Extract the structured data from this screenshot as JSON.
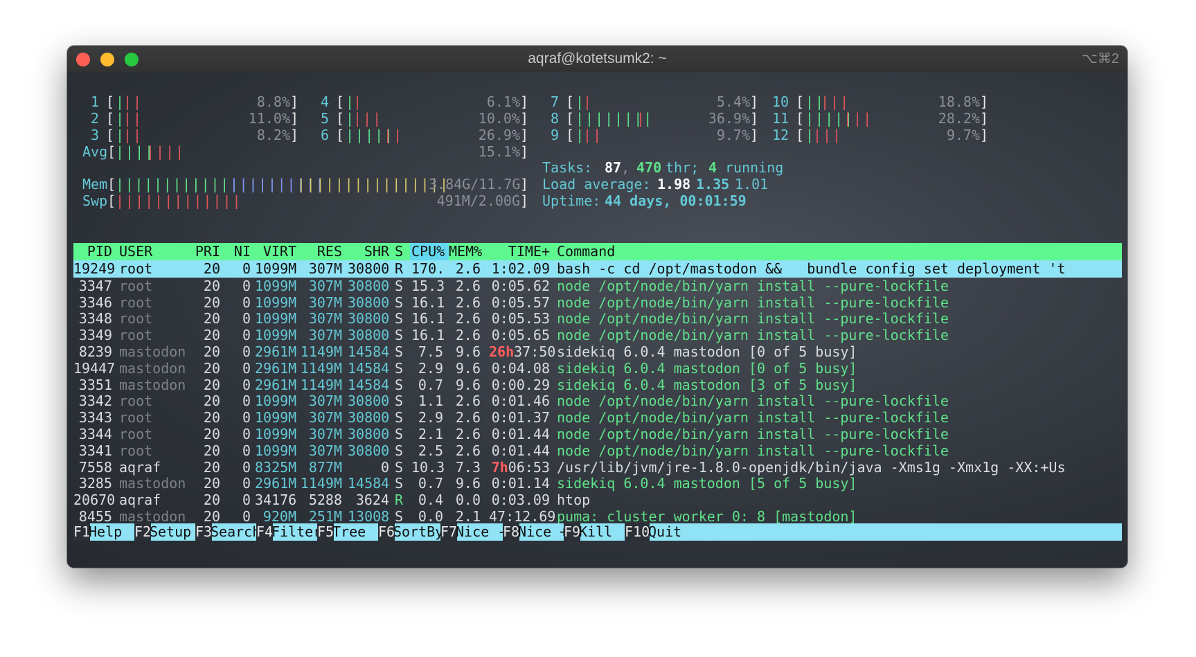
{
  "window": {
    "title": "aqraf@kotetsumk2: ~",
    "shortcut": "⌥⌘2"
  },
  "meters": {
    "cpus": [
      {
        "id": "1",
        "pct": "8.8%",
        "green": "|",
        "red": "||"
      },
      {
        "id": "2",
        "pct": "11.0%",
        "green": "|",
        "red": "||"
      },
      {
        "id": "3",
        "pct": "8.2%",
        "green": "|",
        "red": "||"
      },
      {
        "id": "4",
        "pct": "6.1%",
        "green": "|",
        "red": "|"
      },
      {
        "id": "5",
        "pct": "10.0%",
        "green": "|",
        "red": "|||"
      },
      {
        "id": "6",
        "pct": "26.9%",
        "green": "|||||",
        "red": "||"
      },
      {
        "id": "7",
        "pct": "5.4%",
        "green": "|",
        "red": "|"
      },
      {
        "id": "8",
        "pct": "36.9%",
        "green": "||||||||",
        "red": "|"
      },
      {
        "id": "9",
        "pct": "9.7%",
        "green": "|",
        "red": "||"
      },
      {
        "id": "10",
        "pct": "18.8%",
        "green": "||",
        "red": "|||"
      },
      {
        "id": "11",
        "pct": "28.2%",
        "green": "|||||",
        "red": "|||"
      },
      {
        "id": "12",
        "pct": "9.7%",
        "green": "|",
        "red": "|||"
      }
    ],
    "avg": {
      "label": "Avg",
      "pct": "15.1%",
      "green": "||||",
      "red": "||||"
    },
    "mem": {
      "label": "Mem",
      "green": "|||||||||||||||||",
      "blue": "||||||||||",
      "yellow": "||||||||||||||||",
      "value": "3.84G/11.7G"
    },
    "swp": {
      "label": "Swp",
      "red": "|||||||||||||",
      "value": "491M/2.00G"
    }
  },
  "stats": {
    "tasks_label": "Tasks:",
    "tasks": "87",
    "sep1": ",",
    "thr": "470",
    "thr_label": "thr;",
    "running": "4",
    "running_label": "running",
    "load_label": "Load average:",
    "load1": "1.98",
    "load5": "1.35",
    "load15": "1.01",
    "uptime_label": "Uptime:",
    "uptime": "44 days, 00:01:59"
  },
  "table": {
    "headers": {
      "pid": "PID",
      "user": "USER",
      "pri": "PRI",
      "ni": "NI",
      "virt": "VIRT",
      "res": "RES",
      "shr": "SHR",
      "s": "S",
      "cpu": "CPU%",
      "mem": "MEM%",
      "time": "TIME+",
      "cmd": "Command"
    },
    "rows": [
      {
        "pid": "19249",
        "user": "root",
        "pri": "20",
        "ni": "0",
        "virt": "1099M",
        "res": "307M",
        "shr": "30800",
        "s": "R",
        "cpu": "170.",
        "mem": "2.6",
        "time_h": "",
        "time": "1:02.09",
        "cmd": "bash -c cd /opt/mastodon &&   bundle config set deployment 't"
      },
      {
        "pid": "3347",
        "user": "root",
        "pri": "20",
        "ni": "0",
        "virt": "1099M",
        "res": "307M",
        "shr": "30800",
        "s": "S",
        "cpu": "15.3",
        "mem": "2.6",
        "time_h": "",
        "time": "0:05.62",
        "cmd": "node /opt/node/bin/yarn install --pure-lockfile"
      },
      {
        "pid": "3346",
        "user": "root",
        "pri": "20",
        "ni": "0",
        "virt": "1099M",
        "res": "307M",
        "shr": "30800",
        "s": "S",
        "cpu": "16.1",
        "mem": "2.6",
        "time_h": "",
        "time": "0:05.57",
        "cmd": "node /opt/node/bin/yarn install --pure-lockfile"
      },
      {
        "pid": "3348",
        "user": "root",
        "pri": "20",
        "ni": "0",
        "virt": "1099M",
        "res": "307M",
        "shr": "30800",
        "s": "S",
        "cpu": "16.1",
        "mem": "2.6",
        "time_h": "",
        "time": "0:05.53",
        "cmd": "node /opt/node/bin/yarn install --pure-lockfile"
      },
      {
        "pid": "3349",
        "user": "root",
        "pri": "20",
        "ni": "0",
        "virt": "1099M",
        "res": "307M",
        "shr": "30800",
        "s": "S",
        "cpu": "16.1",
        "mem": "2.6",
        "time_h": "",
        "time": "0:05.65",
        "cmd": "node /opt/node/bin/yarn install --pure-lockfile"
      },
      {
        "pid": "8239",
        "user": "mastodon",
        "pri": "20",
        "ni": "0",
        "virt": "2961M",
        "res": "1149M",
        "shr": "14584",
        "s": "S",
        "cpu": "7.5",
        "mem": "9.6",
        "time_h": "26h",
        "time": "37:50",
        "cmd": "sidekiq 6.0.4 mastodon [0 of 5 busy]"
      },
      {
        "pid": "19447",
        "user": "mastodon",
        "pri": "20",
        "ni": "0",
        "virt": "2961M",
        "res": "1149M",
        "shr": "14584",
        "s": "S",
        "cpu": "2.9",
        "mem": "9.6",
        "time_h": "",
        "time": "0:04.08",
        "cmd": "sidekiq 6.0.4 mastodon [0 of 5 busy]"
      },
      {
        "pid": "3351",
        "user": "mastodon",
        "pri": "20",
        "ni": "0",
        "virt": "2961M",
        "res": "1149M",
        "shr": "14584",
        "s": "S",
        "cpu": "0.7",
        "mem": "9.6",
        "time_h": "",
        "time": "0:00.29",
        "cmd": "sidekiq 6.0.4 mastodon [3 of 5 busy]"
      },
      {
        "pid": "3342",
        "user": "root",
        "pri": "20",
        "ni": "0",
        "virt": "1099M",
        "res": "307M",
        "shr": "30800",
        "s": "S",
        "cpu": "1.1",
        "mem": "2.6",
        "time_h": "",
        "time": "0:01.46",
        "cmd": "node /opt/node/bin/yarn install --pure-lockfile"
      },
      {
        "pid": "3343",
        "user": "root",
        "pri": "20",
        "ni": "0",
        "virt": "1099M",
        "res": "307M",
        "shr": "30800",
        "s": "S",
        "cpu": "2.9",
        "mem": "2.6",
        "time_h": "",
        "time": "0:01.37",
        "cmd": "node /opt/node/bin/yarn install --pure-lockfile"
      },
      {
        "pid": "3344",
        "user": "root",
        "pri": "20",
        "ni": "0",
        "virt": "1099M",
        "res": "307M",
        "shr": "30800",
        "s": "S",
        "cpu": "2.1",
        "mem": "2.6",
        "time_h": "",
        "time": "0:01.44",
        "cmd": "node /opt/node/bin/yarn install --pure-lockfile"
      },
      {
        "pid": "3341",
        "user": "root",
        "pri": "20",
        "ni": "0",
        "virt": "1099M",
        "res": "307M",
        "shr": "30800",
        "s": "S",
        "cpu": "2.5",
        "mem": "2.6",
        "time_h": "",
        "time": "0:01.44",
        "cmd": "node /opt/node/bin/yarn install --pure-lockfile"
      },
      {
        "pid": "7558",
        "user": "aqraf",
        "pri": "20",
        "ni": "0",
        "virt": "8325M",
        "res": "877M",
        "shr": "0",
        "s": "S",
        "cpu": "10.3",
        "mem": "7.3",
        "time_h": "7h",
        "time": "06:53",
        "cmd": "/usr/lib/jvm/jre-1.8.0-openjdk/bin/java -Xms1g -Xmx1g -XX:+Us"
      },
      {
        "pid": "3285",
        "user": "mastodon",
        "pri": "20",
        "ni": "0",
        "virt": "2961M",
        "res": "1149M",
        "shr": "14584",
        "s": "S",
        "cpu": "0.7",
        "mem": "9.6",
        "time_h": "",
        "time": "0:01.14",
        "cmd": "sidekiq 6.0.4 mastodon [5 of 5 busy]"
      },
      {
        "pid": "20670",
        "user": "aqraf",
        "pri": "20",
        "ni": "0",
        "virt": "34176",
        "res": "5288",
        "shr": "3624",
        "s": "R",
        "cpu": "0.4",
        "mem": "0.0",
        "time_h": "",
        "time": "0:03.09",
        "cmd": "htop"
      },
      {
        "pid": "8455",
        "user": "mastodon",
        "pri": "20",
        "ni": "0",
        "virt": "920M",
        "res": "251M",
        "shr": "13008",
        "s": "S",
        "cpu": "0.0",
        "mem": "2.1",
        "time_h": "",
        "time": "47:12.69",
        "cmd": "puma: cluster worker 0: 8 [mastodon]"
      }
    ]
  },
  "footer": [
    {
      "key": "F1",
      "label": "Help"
    },
    {
      "key": "F2",
      "label": "Setup"
    },
    {
      "key": "F3",
      "label": "Search"
    },
    {
      "key": "F4",
      "label": "Filter"
    },
    {
      "key": "F5",
      "label": "Tree"
    },
    {
      "key": "F6",
      "label": "SortBy"
    },
    {
      "key": "F7",
      "label": "Nice -"
    },
    {
      "key": "F8",
      "label": "Nice +"
    },
    {
      "key": "F9",
      "label": "Kill"
    },
    {
      "key": "F10",
      "label": "Quit"
    }
  ]
}
